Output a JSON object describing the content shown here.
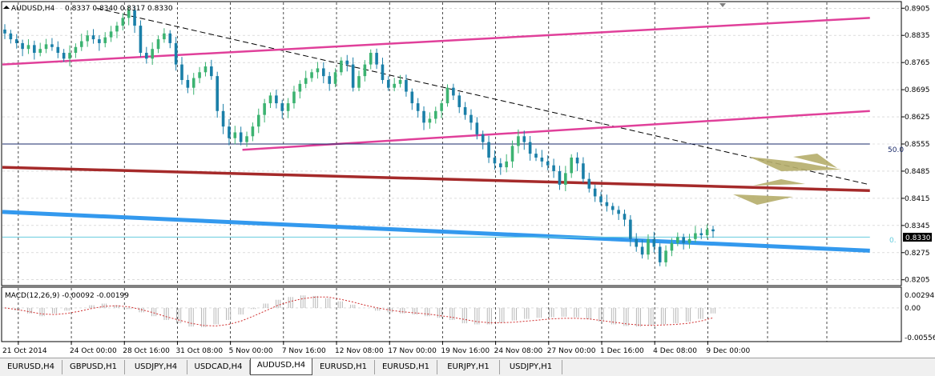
{
  "window": {
    "symbol_header": "AUDUSD,H4",
    "ohlc_header": "0.8337 0.8340 0.8317 0.8330"
  },
  "price_scale": {
    "labels": [
      "0.8905",
      "0.8835",
      "0.8765",
      "0.8695",
      "0.8625",
      "0.8555",
      "0.8485",
      "0.8415",
      "0.8345",
      "0.8275",
      "0.8205"
    ],
    "current_price": "0.8330",
    "fib_50_label": "50.0",
    "fib_0_label": "0."
  },
  "macd": {
    "header": "MACD(12,26,9) -0.00092 -0.00199",
    "labels": [
      "0.00294",
      "0.00",
      "-0.00556"
    ]
  },
  "time_axis": {
    "labels": [
      "21 Oct 2014",
      "24 Oct 00:00",
      "28 Oct 16:00",
      "31 Oct 08:00",
      "5 Nov 00:00",
      "7 Nov 16:00",
      "12 Nov 08:00",
      "17 Nov 00:00",
      "19 Nov 16:00",
      "24 Nov 08:00",
      "27 Nov 00:00",
      "1 Dec 16:00",
      "4 Dec 08:00",
      "9 Dec 00:00"
    ]
  },
  "tabs": [
    {
      "label": "EURUSD,H4",
      "active": false
    },
    {
      "label": "GBPUSD,H1",
      "active": false
    },
    {
      "label": "USDJPY,H4",
      "active": false
    },
    {
      "label": "USDCAD,H4",
      "active": false
    },
    {
      "label": "AUDUSD,H4",
      "active": true
    },
    {
      "label": "EURUSD,H1",
      "active": false
    },
    {
      "label": "EURUSD,H1",
      "active": false
    },
    {
      "label": "EURJPY,H1",
      "active": false
    },
    {
      "label": "USDJPY,H1",
      "active": false
    }
  ],
  "chart_data": {
    "type": "candlestick",
    "series_close": [
      0.884,
      0.8825,
      0.8815,
      0.88,
      0.881,
      0.879,
      0.88,
      0.8812,
      0.8805,
      0.879,
      0.8775,
      0.879,
      0.8805,
      0.882,
      0.8835,
      0.8825,
      0.8815,
      0.883,
      0.8845,
      0.886,
      0.888,
      0.89,
      0.886,
      0.879,
      0.8775,
      0.88,
      0.8825,
      0.884,
      0.8815,
      0.876,
      0.872,
      0.87,
      0.8725,
      0.874,
      0.8755,
      0.873,
      0.864,
      0.86,
      0.857,
      0.8585,
      0.856,
      0.8575,
      0.86,
      0.863,
      0.866,
      0.868,
      0.866,
      0.864,
      0.866,
      0.869,
      0.871,
      0.8725,
      0.874,
      0.875,
      0.873,
      0.871,
      0.874,
      0.877,
      0.876,
      0.87,
      0.873,
      0.876,
      0.879,
      0.876,
      0.872,
      0.87,
      0.871,
      0.872,
      0.869,
      0.866,
      0.864,
      0.861,
      0.862,
      0.864,
      0.866,
      0.87,
      0.868,
      0.865,
      0.863,
      0.861,
      0.858,
      0.856,
      0.852,
      0.8505,
      0.8495,
      0.851,
      0.855,
      0.8575,
      0.856,
      0.853,
      0.852,
      0.851,
      0.85,
      0.8485,
      0.845,
      0.848,
      0.852,
      0.8505,
      0.8465,
      0.844,
      0.842,
      0.8405,
      0.8395,
      0.8385,
      0.8375,
      0.836,
      0.831,
      0.829,
      0.827,
      0.831,
      0.829,
      0.825,
      0.828,
      0.83,
      0.8315,
      0.83,
      0.831,
      0.8325,
      0.832,
      0.8335,
      0.833
    ],
    "y_range": [
      0.819,
      0.892
    ],
    "price_ticks": [
      0.8905,
      0.8835,
      0.8765,
      0.8695,
      0.8625,
      0.8555,
      0.8485,
      0.8415,
      0.8345,
      0.8275,
      0.8205
    ],
    "current_price": 0.833,
    "lines": [
      {
        "name": "descending-trendline",
        "color": "#000000",
        "style": "dashed",
        "from": [
          0.8905,
          0.105
        ],
        "to": [
          0.845,
          0.965
        ]
      },
      {
        "name": "upper-channel-line",
        "color": "#e0409a",
        "style": "solid",
        "from": [
          0.876,
          0.0
        ],
        "to": [
          0.888,
          0.965
        ]
      },
      {
        "name": "lower-channel-line",
        "color": "#e0409a",
        "style": "solid",
        "from": [
          0.854,
          0.267
        ],
        "to": [
          0.864,
          0.965
        ]
      },
      {
        "name": "fib-50-level",
        "color": "#1a2a6a",
        "style": "solid",
        "from": [
          0.8555,
          0.0
        ],
        "to": [
          0.8555,
          0.965
        ]
      },
      {
        "name": "dark-red-support-line",
        "color": "#a52a2a",
        "style": "solid",
        "from": [
          0.8495,
          0.0
        ],
        "to": [
          0.8435,
          0.965
        ]
      },
      {
        "name": "blue-support-line",
        "color": "#3399ee",
        "style": "solid",
        "from": [
          0.838,
          0.0
        ],
        "to": [
          0.828,
          0.965
        ]
      },
      {
        "name": "fib-0-level",
        "color": "#66ccdd",
        "style": "solid",
        "from": [
          0.8315,
          0.0
        ],
        "to": [
          0.8315,
          0.965
        ]
      }
    ],
    "macd": {
      "y_range": [
        -0.006,
        0.0035
      ],
      "histogram": [
        0.0,
        -0.0005,
        -0.001,
        -0.0015,
        -0.001,
        -0.0005,
        0.0,
        0.0005,
        0.0008,
        0.0005,
        -0.0002,
        -0.0008,
        -0.0015,
        -0.0022,
        -0.0028,
        -0.0034,
        -0.0035,
        -0.003,
        -0.0022,
        -0.0012,
        -0.0002,
        0.0008,
        0.0015,
        0.002,
        0.0023,
        0.0022,
        0.0018,
        0.0012,
        0.0006,
        0.0,
        -0.0005,
        -0.0008,
        -0.001,
        -0.0012,
        -0.0015,
        -0.0018,
        -0.0022,
        -0.0028,
        -0.003,
        -0.003,
        -0.0027,
        -0.0023,
        -0.002,
        -0.0018,
        -0.0017,
        -0.0016,
        -0.0017,
        -0.002,
        -0.0025,
        -0.003,
        -0.0033,
        -0.0034,
        -0.0032,
        -0.003,
        -0.0028,
        -0.0025,
        -0.002,
        -0.001
      ],
      "signal": [
        0.0,
        -0.0003,
        -0.0007,
        -0.0011,
        -0.0012,
        -0.001,
        -0.0006,
        -0.0001,
        0.0003,
        0.0004,
        0.0002,
        -0.0003,
        -0.0009,
        -0.0016,
        -0.0022,
        -0.0028,
        -0.0032,
        -0.0033,
        -0.003,
        -0.0024,
        -0.0015,
        -0.0005,
        0.0005,
        0.0012,
        0.0017,
        0.002,
        0.002,
        0.0016,
        0.0011,
        0.0005,
        0.0,
        -0.0004,
        -0.0007,
        -0.0009,
        -0.0011,
        -0.0014,
        -0.0017,
        -0.0021,
        -0.0025,
        -0.0027,
        -0.0027,
        -0.0026,
        -0.0024,
        -0.0022,
        -0.002,
        -0.0019,
        -0.0019,
        -0.002,
        -0.0023,
        -0.0026,
        -0.0029,
        -0.0031,
        -0.0032,
        -0.0031,
        -0.003,
        -0.0028,
        -0.0024,
        -0.0018
      ]
    },
    "colors": {
      "bull": "#3cb371",
      "bear": "#1a7fa8",
      "grid": "#000000",
      "macd_hist": "#b0b0b0",
      "macd_signal": "#d03030",
      "arrow": "#b5ad6a"
    }
  }
}
